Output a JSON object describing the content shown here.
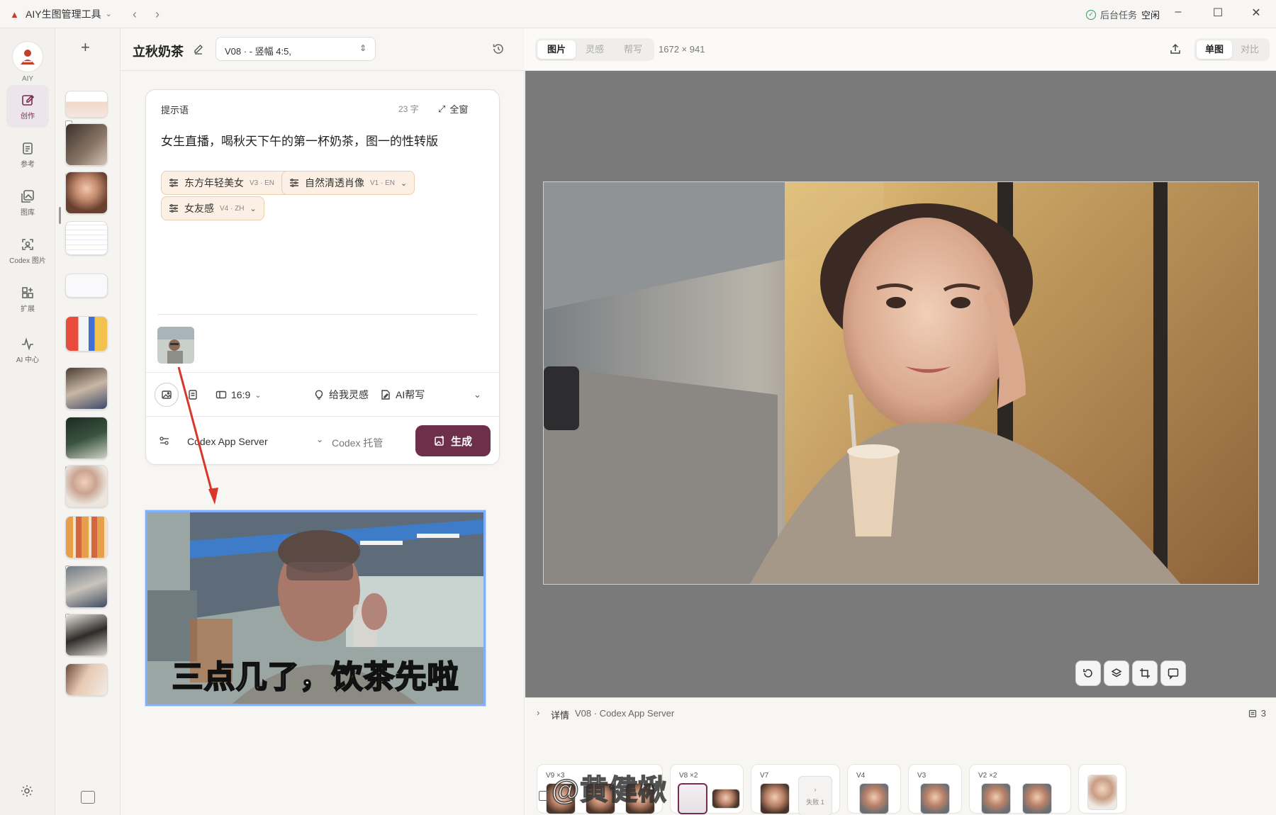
{
  "titlebar": {
    "app_title": "AIY生图管理工具",
    "bg_task_label": "后台任务",
    "bg_task_status": "空闲"
  },
  "rail": {
    "logo_label": "AIY",
    "items": [
      {
        "label": "创作",
        "icon": "pencil-square-icon",
        "active": true
      },
      {
        "label": "参考",
        "icon": "document-icon",
        "active": false
      },
      {
        "label": "图库",
        "icon": "gallery-icon",
        "active": false
      },
      {
        "label": "Codex 图片",
        "icon": "scan-image-icon",
        "active": false
      },
      {
        "label": "扩展",
        "icon": "grid-plus-icon",
        "active": false
      },
      {
        "label": "AI 中心",
        "icon": "pulse-icon",
        "active": false
      }
    ]
  },
  "editor": {
    "project_title": "立秋奶茶",
    "version_select": "V08 · - 竖幅 4:5,",
    "prompt_label": "提示语",
    "char_count": "23 字",
    "fullscreen_label": "全窗",
    "prompt_text": "女生直播，喝秋天下午的第一杯奶茶，图一的性转版",
    "tags": [
      {
        "label": "东方年轻美女",
        "ver": "V3 · EN"
      },
      {
        "label": "自然清透肖像",
        "ver": "V1 · EN"
      },
      {
        "label": "女友感",
        "ver": "V4 · ZH"
      }
    ],
    "aspect_ratio": "16:9",
    "inspire_label": "给我灵感",
    "ai_write_label": "AI帮写",
    "server_label": "Codex App Server",
    "hosting_label": "Codex 托管",
    "generate_label": "生成",
    "meme_caption": "三点几了，饮茶先啦"
  },
  "viewer": {
    "tabs": [
      "图片",
      "灵感",
      "帮写"
    ],
    "dimensions": "1672 × 941",
    "modes": [
      "单图",
      "对比"
    ],
    "details_label": "详情",
    "details_sub": "V08 · Codex App Server",
    "details_count": "3",
    "history": [
      {
        "label": "V9 ×3"
      },
      {
        "label": "V8 ×2"
      },
      {
        "label": "V7"
      },
      {
        "label": "V4"
      },
      {
        "label": "V3"
      },
      {
        "label": "V2 ×2"
      }
    ],
    "fail_label": "失败 1",
    "watermark": "@黄健楸"
  },
  "colors": {
    "accent": "#6e2f4a",
    "tag_bg": "#fbf0e3",
    "canvas_bg": "#7a7a7a"
  }
}
